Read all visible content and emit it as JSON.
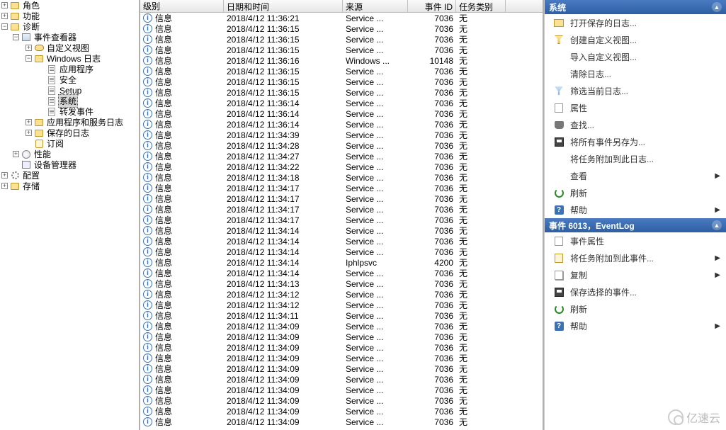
{
  "tree": [
    {
      "indent": 1,
      "expander": "+",
      "icon": "folder",
      "label": "角色"
    },
    {
      "indent": 1,
      "expander": "+",
      "icon": "folder",
      "label": "功能"
    },
    {
      "indent": 1,
      "expander": "-",
      "icon": "folder",
      "label": "诊断"
    },
    {
      "indent": 2,
      "expander": "-",
      "icon": "viewer",
      "label": "事件查看器"
    },
    {
      "indent": 3,
      "expander": "+",
      "icon": "eye",
      "label": "自定义视图"
    },
    {
      "indent": 3,
      "expander": "-",
      "icon": "folder",
      "label": "Windows 日志"
    },
    {
      "indent": 4,
      "expander": "",
      "icon": "doc",
      "label": "应用程序"
    },
    {
      "indent": 4,
      "expander": "",
      "icon": "doc",
      "label": "安全"
    },
    {
      "indent": 4,
      "expander": "",
      "icon": "doc",
      "label": "Setup"
    },
    {
      "indent": 4,
      "expander": "",
      "icon": "doc",
      "label": "系统",
      "selected": true
    },
    {
      "indent": 4,
      "expander": "",
      "icon": "doc",
      "label": "转发事件"
    },
    {
      "indent": 3,
      "expander": "+",
      "icon": "folder",
      "label": "应用程序和服务日志"
    },
    {
      "indent": 3,
      "expander": "+",
      "icon": "folder",
      "label": "保存的日志"
    },
    {
      "indent": 3,
      "expander": "",
      "icon": "scroll",
      "label": "订阅"
    },
    {
      "indent": 2,
      "expander": "+",
      "icon": "perf",
      "label": "性能"
    },
    {
      "indent": 2,
      "expander": "",
      "icon": "device",
      "label": "设备管理器"
    },
    {
      "indent": 1,
      "expander": "+",
      "icon": "gear",
      "label": "配置"
    },
    {
      "indent": 1,
      "expander": "+",
      "icon": "folder",
      "label": "存储"
    }
  ],
  "event_columns": {
    "level": "级别",
    "date": "日期和时间",
    "source": "来源",
    "id": "事件 ID",
    "task": "任务类别"
  },
  "events": [
    {
      "level": "信息",
      "date": "2018/4/12 11:36:21",
      "source": "Service ...",
      "id": "7036",
      "task": "无"
    },
    {
      "level": "信息",
      "date": "2018/4/12 11:36:15",
      "source": "Service ...",
      "id": "7036",
      "task": "无"
    },
    {
      "level": "信息",
      "date": "2018/4/12 11:36:15",
      "source": "Service ...",
      "id": "7036",
      "task": "无"
    },
    {
      "level": "信息",
      "date": "2018/4/12 11:36:15",
      "source": "Service ...",
      "id": "7036",
      "task": "无"
    },
    {
      "level": "信息",
      "date": "2018/4/12 11:36:16",
      "source": "Windows ...",
      "id": "10148",
      "task": "无"
    },
    {
      "level": "信息",
      "date": "2018/4/12 11:36:15",
      "source": "Service ...",
      "id": "7036",
      "task": "无"
    },
    {
      "level": "信息",
      "date": "2018/4/12 11:36:15",
      "source": "Service ...",
      "id": "7036",
      "task": "无"
    },
    {
      "level": "信息",
      "date": "2018/4/12 11:36:15",
      "source": "Service ...",
      "id": "7036",
      "task": "无"
    },
    {
      "level": "信息",
      "date": "2018/4/12 11:36:14",
      "source": "Service ...",
      "id": "7036",
      "task": "无"
    },
    {
      "level": "信息",
      "date": "2018/4/12 11:36:14",
      "source": "Service ...",
      "id": "7036",
      "task": "无"
    },
    {
      "level": "信息",
      "date": "2018/4/12 11:36:14",
      "source": "Service ...",
      "id": "7036",
      "task": "无"
    },
    {
      "level": "信息",
      "date": "2018/4/12 11:34:39",
      "source": "Service ...",
      "id": "7036",
      "task": "无"
    },
    {
      "level": "信息",
      "date": "2018/4/12 11:34:28",
      "source": "Service ...",
      "id": "7036",
      "task": "无"
    },
    {
      "level": "信息",
      "date": "2018/4/12 11:34:27",
      "source": "Service ...",
      "id": "7036",
      "task": "无"
    },
    {
      "level": "信息",
      "date": "2018/4/12 11:34:22",
      "source": "Service ...",
      "id": "7036",
      "task": "无"
    },
    {
      "level": "信息",
      "date": "2018/4/12 11:34:18",
      "source": "Service ...",
      "id": "7036",
      "task": "无"
    },
    {
      "level": "信息",
      "date": "2018/4/12 11:34:17",
      "source": "Service ...",
      "id": "7036",
      "task": "无"
    },
    {
      "level": "信息",
      "date": "2018/4/12 11:34:17",
      "source": "Service ...",
      "id": "7036",
      "task": "无"
    },
    {
      "level": "信息",
      "date": "2018/4/12 11:34:17",
      "source": "Service ...",
      "id": "7036",
      "task": "无"
    },
    {
      "level": "信息",
      "date": "2018/4/12 11:34:17",
      "source": "Service ...",
      "id": "7036",
      "task": "无"
    },
    {
      "level": "信息",
      "date": "2018/4/12 11:34:14",
      "source": "Service ...",
      "id": "7036",
      "task": "无"
    },
    {
      "level": "信息",
      "date": "2018/4/12 11:34:14",
      "source": "Service ...",
      "id": "7036",
      "task": "无"
    },
    {
      "level": "信息",
      "date": "2018/4/12 11:34:14",
      "source": "Service ...",
      "id": "7036",
      "task": "无"
    },
    {
      "level": "信息",
      "date": "2018/4/12 11:34:14",
      "source": "Iphlpsvc",
      "id": "4200",
      "task": "无"
    },
    {
      "level": "信息",
      "date": "2018/4/12 11:34:14",
      "source": "Service ...",
      "id": "7036",
      "task": "无"
    },
    {
      "level": "信息",
      "date": "2018/4/12 11:34:13",
      "source": "Service ...",
      "id": "7036",
      "task": "无"
    },
    {
      "level": "信息",
      "date": "2018/4/12 11:34:12",
      "source": "Service ...",
      "id": "7036",
      "task": "无"
    },
    {
      "level": "信息",
      "date": "2018/4/12 11:34:12",
      "source": "Service ...",
      "id": "7036",
      "task": "无"
    },
    {
      "level": "信息",
      "date": "2018/4/12 11:34:11",
      "source": "Service ...",
      "id": "7036",
      "task": "无"
    },
    {
      "level": "信息",
      "date": "2018/4/12 11:34:09",
      "source": "Service ...",
      "id": "7036",
      "task": "无"
    },
    {
      "level": "信息",
      "date": "2018/4/12 11:34:09",
      "source": "Service ...",
      "id": "7036",
      "task": "无"
    },
    {
      "level": "信息",
      "date": "2018/4/12 11:34:09",
      "source": "Service ...",
      "id": "7036",
      "task": "无"
    },
    {
      "level": "信息",
      "date": "2018/4/12 11:34:09",
      "source": "Service ...",
      "id": "7036",
      "task": "无"
    },
    {
      "level": "信息",
      "date": "2018/4/12 11:34:09",
      "source": "Service ...",
      "id": "7036",
      "task": "无"
    },
    {
      "level": "信息",
      "date": "2018/4/12 11:34:09",
      "source": "Service ...",
      "id": "7036",
      "task": "无"
    },
    {
      "level": "信息",
      "date": "2018/4/12 11:34:09",
      "source": "Service ...",
      "id": "7036",
      "task": "无"
    },
    {
      "level": "信息",
      "date": "2018/4/12 11:34:09",
      "source": "Service ...",
      "id": "7036",
      "task": "无"
    },
    {
      "level": "信息",
      "date": "2018/4/12 11:34:09",
      "source": "Service ...",
      "id": "7036",
      "task": "无"
    },
    {
      "level": "信息",
      "date": "2018/4/12 11:34:09",
      "source": "Service ...",
      "id": "7036",
      "task": "无"
    }
  ],
  "actions1": {
    "title": "系统",
    "items": [
      {
        "icon": "open-log",
        "label": "打开保存的日志..."
      },
      {
        "icon": "filter",
        "label": "创建自定义视图..."
      },
      {
        "icon": "",
        "label": "导入自定义视图..."
      },
      {
        "icon": "",
        "label": "清除日志..."
      },
      {
        "icon": "funnel",
        "label": "筛选当前日志..."
      },
      {
        "icon": "prop",
        "label": "属性"
      },
      {
        "icon": "find",
        "label": "查找..."
      },
      {
        "icon": "save",
        "label": "将所有事件另存为..."
      },
      {
        "icon": "",
        "label": "将任务附加到此日志..."
      },
      {
        "icon": "",
        "label": "查看",
        "arrow": true
      },
      {
        "icon": "refresh",
        "label": "刷新"
      },
      {
        "icon": "help",
        "label": "帮助",
        "arrow": true
      }
    ]
  },
  "actions2": {
    "title": "事件 6013，EventLog",
    "items": [
      {
        "icon": "event-prop",
        "label": "事件属性"
      },
      {
        "icon": "attach",
        "label": "将任务附加到此事件...",
        "arrow": true
      },
      {
        "icon": "copy",
        "label": "复制",
        "arrow": true
      },
      {
        "icon": "save",
        "label": "保存选择的事件..."
      },
      {
        "icon": "refresh",
        "label": "刷新"
      },
      {
        "icon": "help",
        "label": "帮助",
        "arrow": true
      }
    ]
  },
  "watermark": "亿速云"
}
